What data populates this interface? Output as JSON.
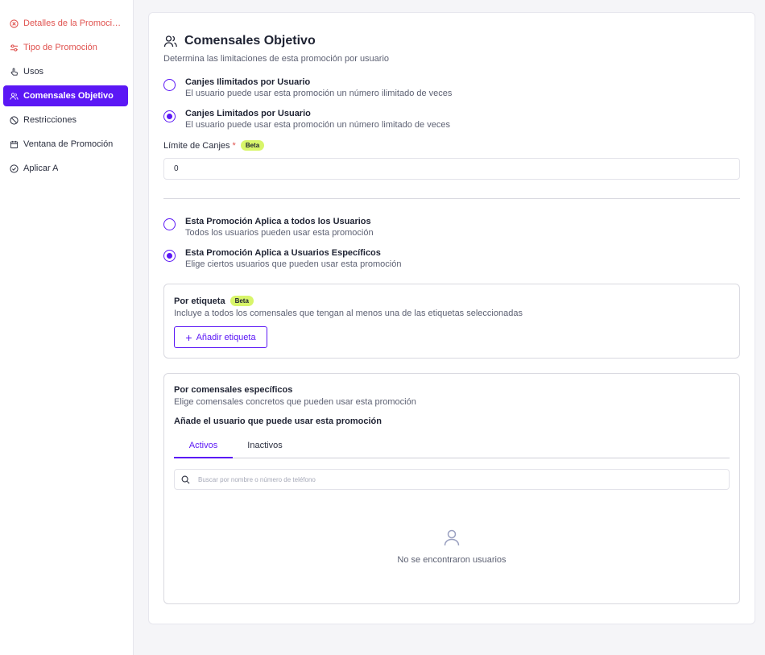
{
  "sidebar": {
    "items": [
      {
        "label": "Detalles de la Promoción",
        "icon": "error-circle-icon",
        "state": "error"
      },
      {
        "label": "Tipo de Promoción",
        "icon": "sliders-icon",
        "state": "error"
      },
      {
        "label": "Usos",
        "icon": "hand-pointer-icon",
        "state": "normal"
      },
      {
        "label": "Comensales Objetivo",
        "icon": "users-icon",
        "state": "active"
      },
      {
        "label": "Restricciones",
        "icon": "ban-icon",
        "state": "normal"
      },
      {
        "label": "Ventana de Promoción",
        "icon": "calendar-icon",
        "state": "normal"
      },
      {
        "label": "Aplicar A",
        "icon": "check-circle-icon",
        "state": "normal"
      }
    ]
  },
  "section": {
    "icon": "users-icon",
    "title": "Comensales Objetivo",
    "subtitle": "Determina las limitaciones de esta promoción por usuario"
  },
  "redemption_options": [
    {
      "title": "Canjes Ilimitados por Usuario",
      "desc": "El usuario puede usar esta promoción un número ilimitado de veces",
      "checked": false
    },
    {
      "title": "Canjes Limitados por Usuario",
      "desc": "El usuario puede usar esta promoción un número limitado de veces",
      "checked": true
    }
  ],
  "limit": {
    "label": "Límite de Canjes",
    "required_mark": "*",
    "badge": "Beta",
    "value": "0"
  },
  "audience_options": [
    {
      "title": "Esta Promoción Aplica a todos los Usuarios",
      "desc": "Todos los usuarios pueden usar esta promoción",
      "checked": false
    },
    {
      "title": "Esta Promoción Aplica a Usuarios Específicos",
      "desc": "Elige ciertos usuarios que pueden usar esta promoción",
      "checked": true
    }
  ],
  "by_tag": {
    "title": "Por etiqueta",
    "badge": "Beta",
    "desc": "Incluye a todos los comensales que tengan al menos una de las etiquetas seleccionadas",
    "button": "Añadir etiqueta"
  },
  "by_diner": {
    "title": "Por comensales específicos",
    "desc": "Elige comensales concretos que pueden usar esta promoción",
    "subheading": "Añade el usuario que puede usar esta promoción",
    "tabs": [
      {
        "label": "Activos",
        "active": true
      },
      {
        "label": "Inactivos",
        "active": false
      }
    ],
    "search_placeholder": "Buscar por nombre o número de teléfono",
    "empty_text": "No se encontraron usuarios"
  },
  "colors": {
    "accent": "#5b17f5",
    "error": "#e0524f",
    "badge": "#d8f56a"
  }
}
